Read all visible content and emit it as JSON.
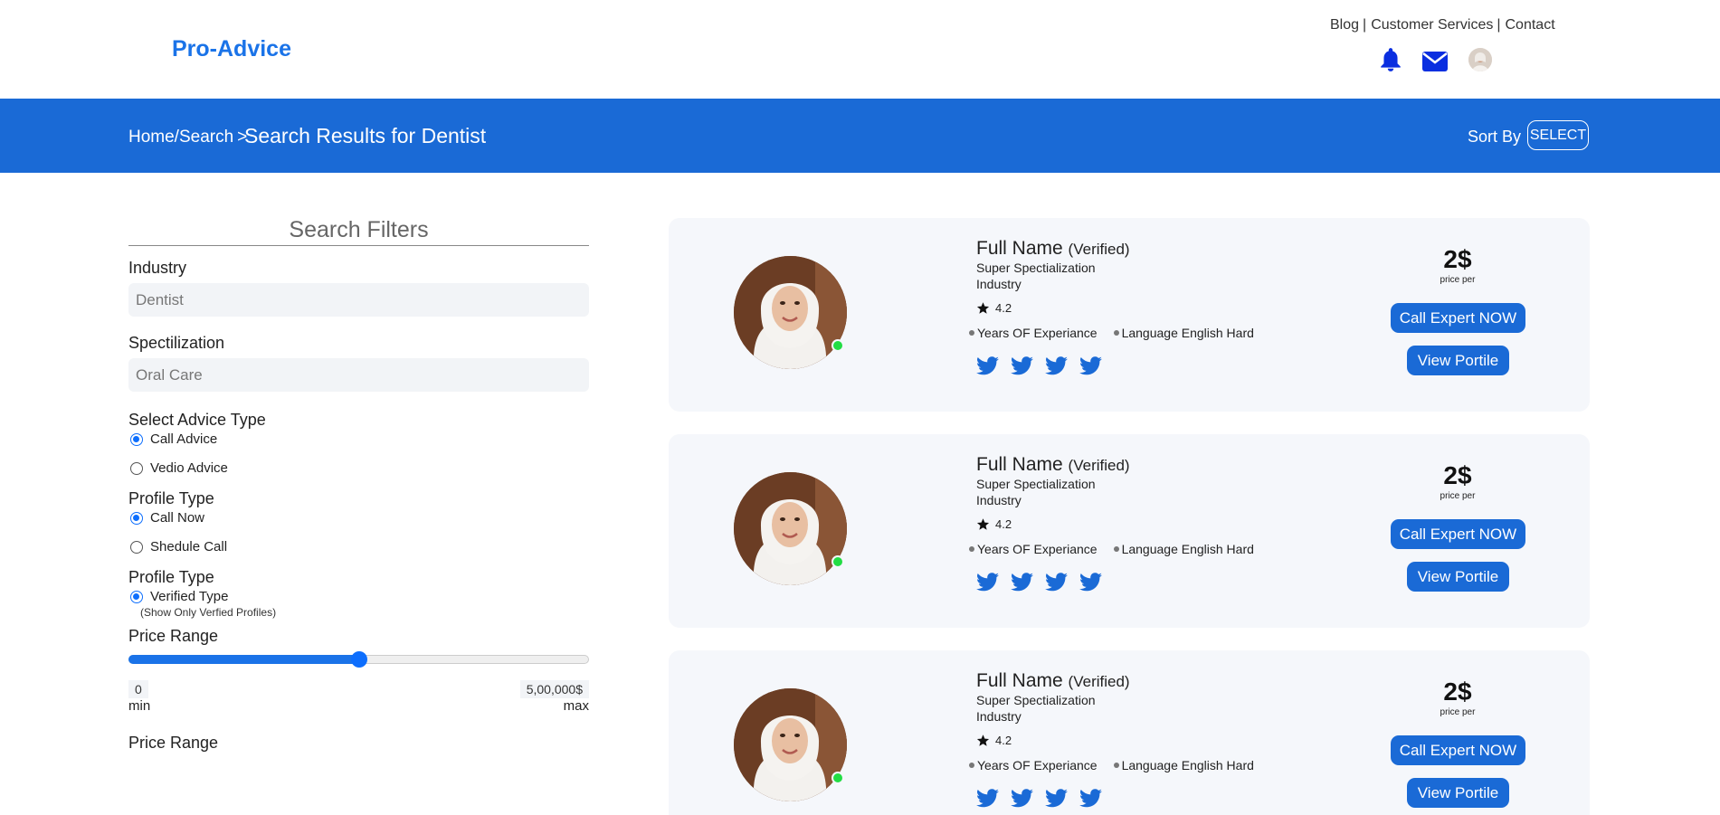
{
  "brand": {
    "name": "Pro-Advice"
  },
  "top_nav": {
    "links": [
      "Blog",
      "Customer Services",
      "Contact"
    ],
    "separator": "|",
    "icons": [
      "bell-icon",
      "envelope-icon",
      "user-avatar"
    ]
  },
  "banner": {
    "breadcrumb": {
      "home_search": "Home/Search",
      "arrow": ">"
    },
    "title": "Search Results for Dentist",
    "sort_label": "Sort By",
    "sort_button": "SELECT"
  },
  "filters": {
    "title": "Search Filters",
    "industry_label": "Industry",
    "industry_value": "Dentist",
    "specialization_label": "Spectilization",
    "specialization_value": "Oral Care",
    "advice_type_label": "Select Advice Type",
    "advice_options": [
      {
        "label": "Call Advice",
        "checked": true
      },
      {
        "label": "Vedio Advice",
        "checked": false
      }
    ],
    "profile_type_label": "Profile Type",
    "profile_options": [
      {
        "label": "Call Now",
        "checked": true
      },
      {
        "label": "Shedule Call",
        "checked": false
      }
    ],
    "profile_type2_label": "Profile Type",
    "verified_option": {
      "label": "Verified Type",
      "checked": true
    },
    "verified_hint": "(Show Only Verfied Profiles)",
    "price_range_label": "Price Range",
    "price_slider_level": 0.5,
    "price_min": "0",
    "price_max": "5,00,000$",
    "min_label": "min",
    "max_label": "max",
    "price_range2_label": "Price Range"
  },
  "experts": [
    {
      "name": "Full Name",
      "verified": "(Verified)",
      "specialization": "Super Spectialization",
      "industry": "Industry",
      "rating": "4.2",
      "experience": "Years OF Experiance",
      "language": "Language English Hard",
      "price": "2$",
      "price_unit": "price per",
      "call_button": "Call Expert NOW",
      "view_button": "View Portile",
      "online": true
    },
    {
      "name": "Full Name",
      "verified": "(Verified)",
      "specialization": "Super Spectialization",
      "industry": "Industry",
      "rating": "4.2",
      "experience": "Years OF Experiance",
      "language": "Language English Hard",
      "price": "2$",
      "price_unit": "price per",
      "call_button": "Call Expert NOW",
      "view_button": "View Portile",
      "online": true
    },
    {
      "name": "Full Name",
      "verified": "(Verified)",
      "specialization": "Super Spectialization",
      "industry": "Industry",
      "rating": "4.2",
      "experience": "Years OF Experiance",
      "language": "Language English Hard",
      "price": "2$",
      "price_unit": "price per",
      "call_button": "Call Expert NOW",
      "view_button": "View Portile",
      "online": true
    }
  ],
  "colors": {
    "brand_blue": "#1a73e8",
    "banner_blue": "#1a6ad6",
    "online_green": "#22dd44",
    "card_bg": "#f5f7fb"
  }
}
